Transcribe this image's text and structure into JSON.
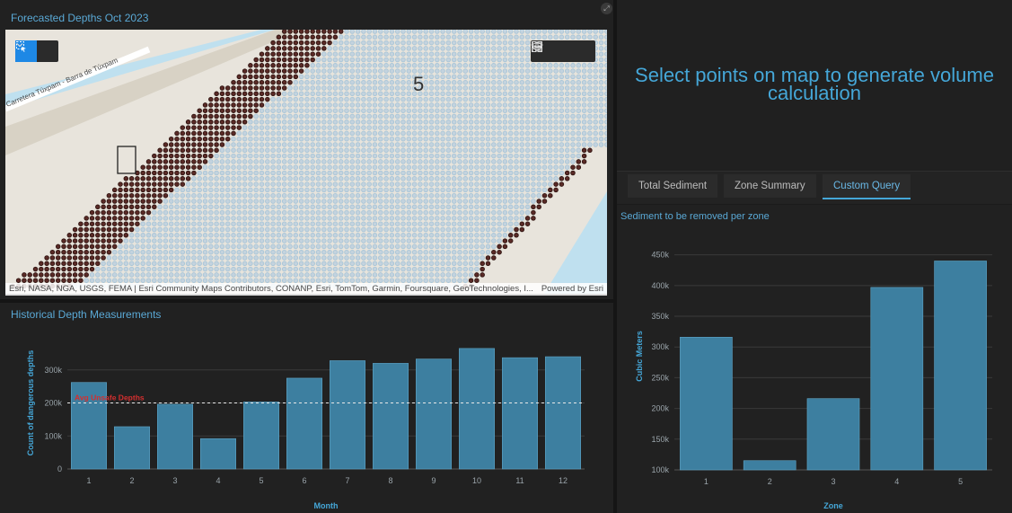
{
  "map": {
    "title": "Forecasted Depths Oct 2023",
    "road_label": "Carretera Túxpam - Barra de Túxpam",
    "zone_label": "5",
    "attribution": "Esri, NASA, NGA, USGS, FEMA | Esri Community Maps Contributors, CONANP, Esri, TomTom, Garmin, Foursquare, GeoTechnologies, I...",
    "powered_by": "Powered by Esri",
    "tools": {
      "select_icon": "selection-rectangle-icon",
      "dropdown_icon": "chevron-down-icon",
      "legend_icon": "list-icon",
      "layers_icon": "layers-icon",
      "basemap_icon": "grid-icon"
    }
  },
  "historical": {
    "title": "Historical Depth Measurements"
  },
  "right": {
    "select_message_line1": "Select points on map to generate volume",
    "select_message_line2": "calculation",
    "tabs": [
      "Total Sediment",
      "Zone Summary",
      "Custom Query"
    ],
    "active_tab": "Custom Query"
  },
  "zones": {
    "title": "Sediment to be removed per zone"
  },
  "colors": {
    "accent": "#45a7d8",
    "bar": "#3d7fa0",
    "threshold": "#d32f2f",
    "dot_dark": "#5a2a26",
    "dot_light": "#a9c6d8"
  },
  "chart_data": [
    {
      "type": "bar",
      "title": "Historical Depth Measurements",
      "xlabel": "Month",
      "ylabel": "Count of dangerous depths",
      "categories": [
        "1",
        "2",
        "3",
        "4",
        "5",
        "6",
        "7",
        "8",
        "9",
        "10",
        "11",
        "12"
      ],
      "values": [
        262000,
        128000,
        196000,
        92000,
        203000,
        275000,
        328000,
        320000,
        333000,
        365000,
        337000,
        340000
      ],
      "ylim": [
        0,
        400000
      ],
      "yticks": [
        0,
        100000,
        200000,
        300000
      ],
      "ytick_labels": [
        "0",
        "100k",
        "200k",
        "300k"
      ],
      "threshold": {
        "value": 200000,
        "label": "Avg Unsafe Depths"
      },
      "grid": true
    },
    {
      "type": "bar",
      "title": "Sediment to be removed per zone",
      "xlabel": "Zone",
      "ylabel": "Cubic Meters",
      "categories": [
        "1",
        "2",
        "3",
        "4",
        "5"
      ],
      "values": [
        316000,
        115000,
        216000,
        397000,
        440000
      ],
      "ylim": [
        100000,
        470000
      ],
      "yticks": [
        100000,
        150000,
        200000,
        250000,
        300000,
        350000,
        400000,
        450000
      ],
      "ytick_labels": [
        "100k",
        "150k",
        "200k",
        "250k",
        "300k",
        "350k",
        "400k",
        "450k"
      ],
      "grid": true
    }
  ]
}
